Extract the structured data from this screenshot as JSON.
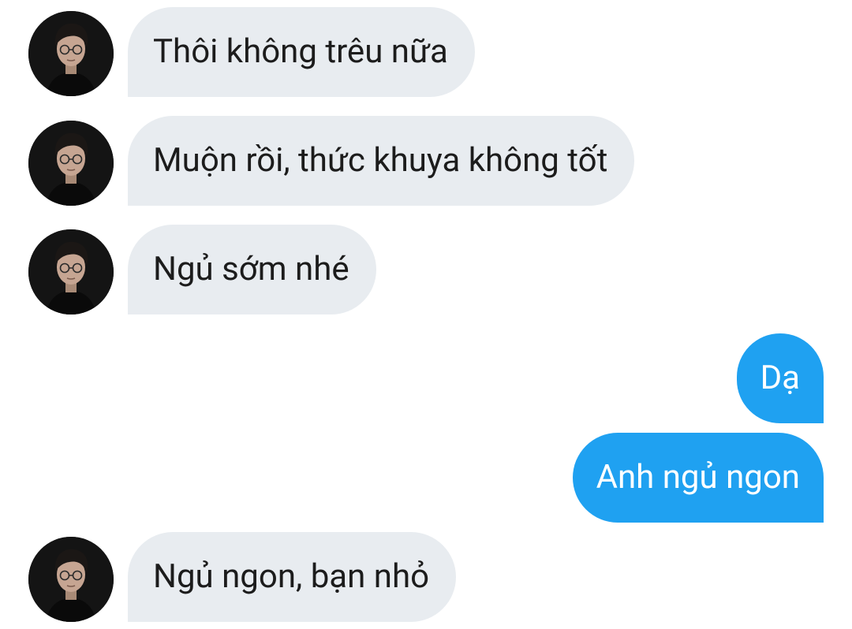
{
  "thread": {
    "messages": [
      {
        "sender": "contact",
        "text": "Thôi không trêu nữa"
      },
      {
        "sender": "contact",
        "text": "Muộn rồi, thức khuya không tốt"
      },
      {
        "sender": "contact",
        "text": "Ngủ sớm nhé"
      },
      {
        "sender": "me",
        "text": "Dạ"
      },
      {
        "sender": "me",
        "text": "Anh ngủ ngon"
      },
      {
        "sender": "contact",
        "text": "Ngủ ngon, bạn nhỏ"
      }
    ]
  },
  "colors": {
    "incoming_bubble": "#e8ecf0",
    "outgoing_bubble": "#1fa1f1",
    "incoming_text": "#1c1c1c",
    "outgoing_text": "#ffffff"
  }
}
